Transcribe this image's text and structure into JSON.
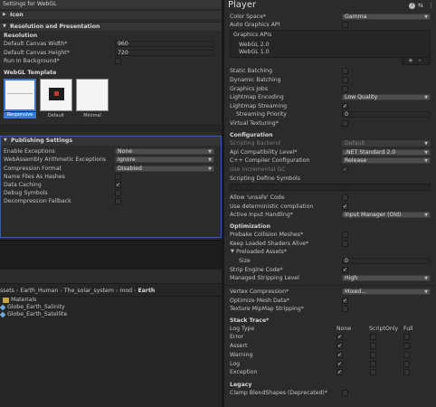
{
  "left": {
    "title": "Settings for WebGL",
    "icon_section": "Icon",
    "res_section": "Resolution and Presentation",
    "resolution": {
      "heading": "Resolution",
      "width_label": "Default Canvas Width*",
      "width_value": "960",
      "height_label": "Default Canvas Height*",
      "height_value": "720",
      "run_bg_label": "Run In Background*"
    },
    "template": {
      "heading": "WebGL Template",
      "items": [
        "Responsive",
        "Default",
        "Minimal"
      ]
    },
    "publishing": {
      "title": "Publishing Settings",
      "rows": [
        {
          "label": "Enable Exceptions",
          "value": "None"
        },
        {
          "label": "WebAssembly Arithmetic Exceptions",
          "value": "Ignore"
        },
        {
          "label": "Compression Format",
          "value": "Disabled"
        },
        {
          "label": "Name Files As Hashes"
        },
        {
          "label": "Data Caching"
        },
        {
          "label": "Debug Symbols"
        },
        {
          "label": "Decompression Fallback"
        }
      ]
    },
    "project": {
      "breadcrumb": [
        "ssets",
        "Earth_Human",
        "The_solar_system",
        "mod",
        "Earth"
      ],
      "items": [
        "Materials",
        "Globe_Earth_Salinity",
        "Globe_Earth_Satellite"
      ]
    }
  },
  "right": {
    "title": "Player",
    "color_space": {
      "label": "Color Space*",
      "value": "Gamma"
    },
    "auto_graphics": "Auto Graphics API",
    "graphics_apis": {
      "label": "Graphics APIs",
      "items": [
        "WebGL 2.0",
        "WebGL 1.0"
      ],
      "add": "+",
      "remove": "-"
    },
    "static_batching": "Static Batching",
    "dynamic_batching": "Dynamic Batching",
    "graphics_jobs": "Graphics Jobs",
    "lightmap_encoding": {
      "label": "Lightmap Encoding",
      "value": "Low Quality"
    },
    "lightmap_streaming": "Lightmap Streaming",
    "streaming_priority": {
      "label": "Streaming Priority",
      "value": "0"
    },
    "virtual_texturing": "Virtual Texturing*",
    "configuration": "Configuration",
    "scripting_backend": {
      "label": "Scripting Backend",
      "value": "Default"
    },
    "api_compat": {
      "label": "Api Compatibility Level*",
      "value": ".NET Standard 2.0"
    },
    "cpp_config": {
      "label": "C++ Compiler Configuration",
      "value": "Release"
    },
    "incremental_gc": "Use incremental GC",
    "define_symbols": "Scripting Define Symbols",
    "allow_unsafe": "Allow 'unsafe' Code",
    "deterministic": "Use deterministic compilation",
    "active_input": {
      "label": "Active Input Handling*",
      "value": "Input Manager (Old)"
    },
    "optimization": "Optimization",
    "prebake": "Prebake Collision Meshes*",
    "keep_shaders": "Keep Loaded Shaders Alive*",
    "preloaded": "Preloaded Assets*",
    "size": {
      "label": "Size",
      "value": "0"
    },
    "strip_engine": "Strip Engine Code*",
    "managed_stripping": {
      "label": "Managed Stripping Level",
      "value": "High"
    },
    "vertex_compression": {
      "label": "Vertex Compression*",
      "value": "Mixed..."
    },
    "optimize_mesh": "Optimize Mesh Data*",
    "texture_mip": "Texture MipMap Stripping*",
    "stack_trace": {
      "title": "Stack Trace*",
      "log_type": "Log Type",
      "cols": [
        "None",
        "ScriptOnly",
        "Full"
      ],
      "rows": [
        "Error",
        "Assert",
        "Warning",
        "Log",
        "Exception"
      ]
    },
    "legacy": "Legacy",
    "clamp": "Clamp BlendShapes (Deprecated)*"
  }
}
